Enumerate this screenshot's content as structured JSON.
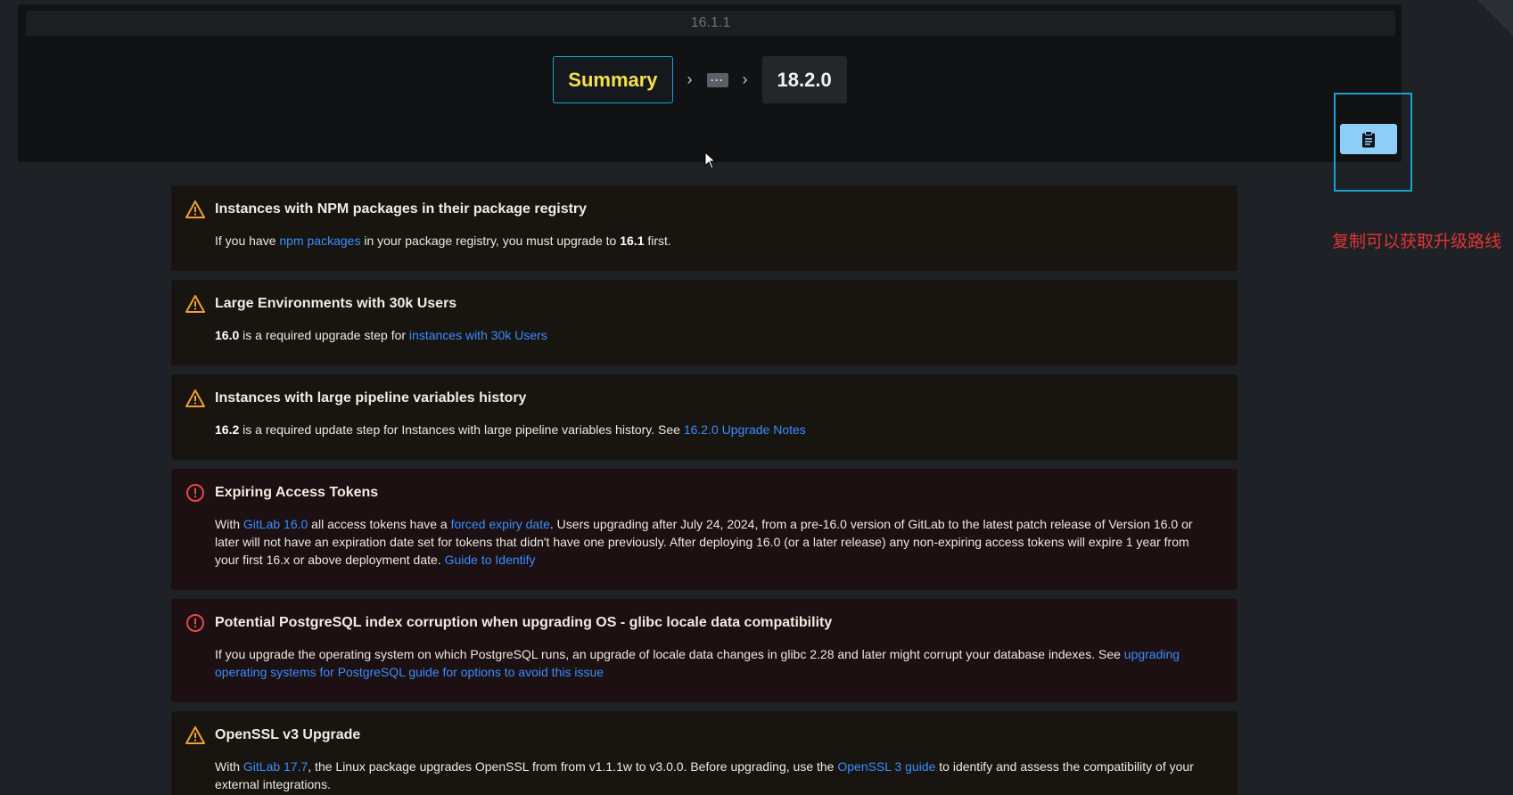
{
  "header": {
    "current_version": "16.1.1",
    "path": {
      "summary_label": "Summary",
      "collapsed_label": "···",
      "target_version": "18.2.0"
    }
  },
  "copy": {
    "icon": "clipboard-icon",
    "note": "复制可以获取升级路线"
  },
  "colors": {
    "warning": "#f0a030",
    "error": "#e5484d",
    "link": "#3a8dff",
    "accent": "#1e9fd4"
  },
  "notices": [
    {
      "type": "warning",
      "title": "Instances with NPM packages in their package registry",
      "t1": "If you have ",
      "l1": "npm packages",
      "t2": " in your package registry, you must upgrade to ",
      "b1": "16.1",
      "t3": " first."
    },
    {
      "type": "warning",
      "title": "Large Environments with 30k Users",
      "b1": "16.0",
      "t1": " is a required upgrade step for ",
      "l1": "instances with 30k Users"
    },
    {
      "type": "warning",
      "title": "Instances with large pipeline variables history",
      "b1": "16.2",
      "t1": " is a required update step for Instances with large pipeline variables history. See ",
      "l1": "16.2.0 Upgrade Notes"
    },
    {
      "type": "error",
      "title": "Expiring Access Tokens",
      "t1": "With ",
      "l1": "GitLab 16.0",
      "t2": " all access tokens have a ",
      "l2": "forced expiry date",
      "t3": ". Users upgrading after July 24, 2024, from a pre-16.0 version of GitLab to the latest patch release of Version 16.0 or later will not have an expiration date set for tokens that didn't have one previously. After deploying 16.0 (or a later release) any non-expiring access tokens will expire 1 year from your first 16.x or above deployment date. ",
      "l3": "Guide to Identify"
    },
    {
      "type": "error",
      "title": "Potential PostgreSQL index corruption when upgrading OS - glibc locale data compatibility",
      "t1": "If you upgrade the operating system on which PostgreSQL runs, an upgrade of locale data changes in glibc 2.28 and later might corrupt your database indexes. See ",
      "l1": "upgrading operating systems for PostgreSQL guide for options to avoid this issue"
    },
    {
      "type": "warning",
      "title": "OpenSSL v3 Upgrade",
      "t1": "With ",
      "l1": "GitLab 17.7",
      "t2": ", the Linux package upgrades OpenSSL from from v1.1.1w to v3.0.0. Before upgrading, use the ",
      "l2": "OpenSSL 3 guide",
      "t3": " to identify and assess the compatibility of your external integrations."
    }
  ]
}
